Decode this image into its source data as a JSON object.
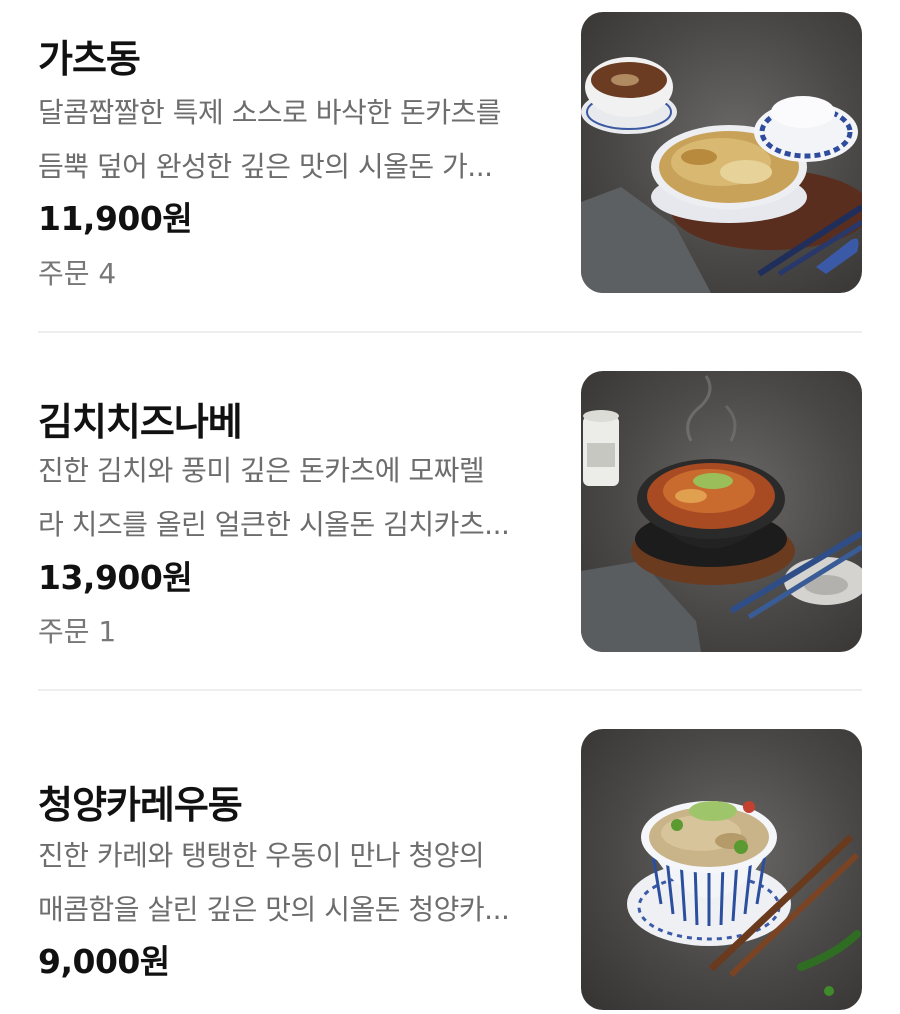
{
  "menu_items": [
    {
      "name": "가츠동",
      "description_line1": "달콤짭짤한 특제 소스로 바삭한 돈카츠를",
      "description_line2": "듬뿍 덮어 완성한 깊은 맛의 시올돈 가...",
      "price": "11,900원",
      "orders": "주문 4"
    },
    {
      "name": "김치치즈나베",
      "description_line1": "진한 김치와 풍미 깊은 돈카츠에 모짜렐",
      "description_line2": "라 치즈를 올린 얼큰한 시올돈 김치카츠...",
      "price": "13,900원",
      "orders": "주문 1"
    },
    {
      "name": "청양카레우동",
      "description_line1": "진한 카레와 탱탱한 우동이 만나 청양의",
      "description_line2": "매콤함을 살린 깊은 맛의 시올돈 청양카...",
      "price": "9,000원"
    }
  ]
}
